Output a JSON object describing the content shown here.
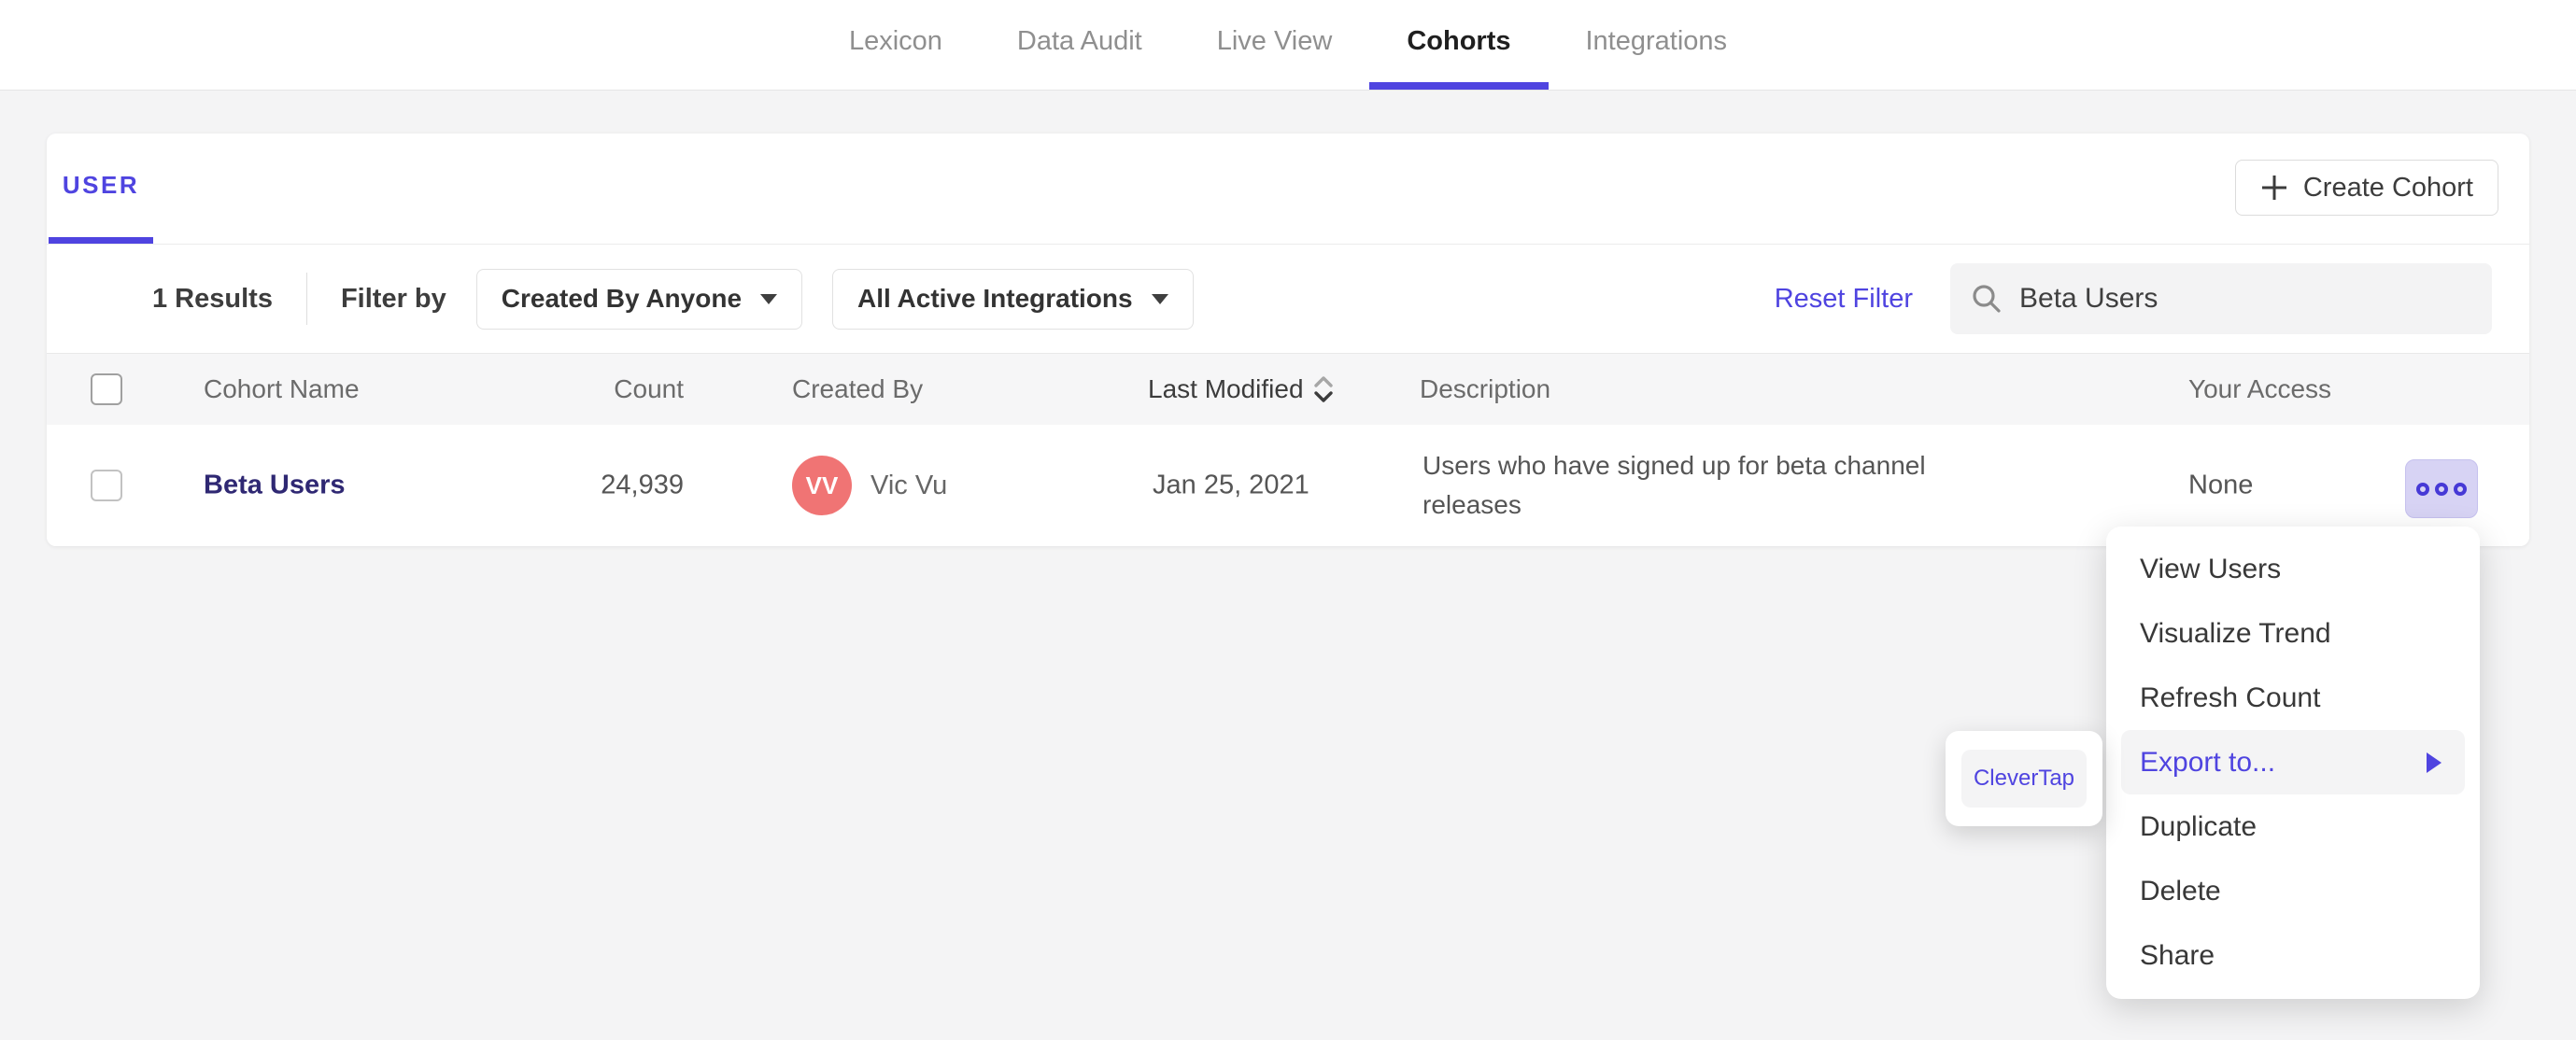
{
  "nav": {
    "items": [
      {
        "label": "Lexicon",
        "active": false
      },
      {
        "label": "Data Audit",
        "active": false
      },
      {
        "label": "Live View",
        "active": false
      },
      {
        "label": "Cohorts",
        "active": true
      },
      {
        "label": "Integrations",
        "active": false
      }
    ]
  },
  "card": {
    "tab_label": "USER",
    "create_button_label": "Create Cohort",
    "filters": {
      "results_count": "1 Results",
      "filter_by_label": "Filter by",
      "created_by_dropdown": "Created By Anyone",
      "integrations_dropdown": "All Active Integrations",
      "reset_link": "Reset Filter",
      "search_value": "Beta Users"
    },
    "table": {
      "headers": {
        "name": "Cohort Name",
        "count": "Count",
        "created_by": "Created By",
        "last_modified": "Last Modified",
        "description": "Description",
        "access": "Your Access"
      },
      "sort": {
        "column": "Last Modified",
        "direction": "descending"
      },
      "row": {
        "name": "Beta Users",
        "count": "24,939",
        "avatar_initials": "VV",
        "created_by": "Vic Vu",
        "last_modified": "Jan 25, 2021",
        "description": "Users who have signed up for beta channel releases",
        "access": "None"
      }
    }
  },
  "context_menu": {
    "items": [
      {
        "label": "View Users",
        "highlighted": false
      },
      {
        "label": "Visualize Trend",
        "highlighted": false
      },
      {
        "label": "Refresh Count",
        "highlighted": false
      },
      {
        "label": "Export to...",
        "highlighted": true,
        "has_submenu": true
      },
      {
        "label": "Duplicate",
        "highlighted": false
      },
      {
        "label": "Delete",
        "highlighted": false
      },
      {
        "label": "Share",
        "highlighted": false
      }
    ]
  },
  "submenu": {
    "items": [
      {
        "label": "CleverTap"
      }
    ]
  },
  "colors": {
    "accent": "#4f44e0",
    "accent-dark": "#2f2873",
    "avatar-bg": "#f07474",
    "page-bg": "#f4f4f5",
    "menu-hl": "#f4f4f5",
    "ooo-bg": "#d7d3f4",
    "ooo-ring": "#4639d6"
  }
}
